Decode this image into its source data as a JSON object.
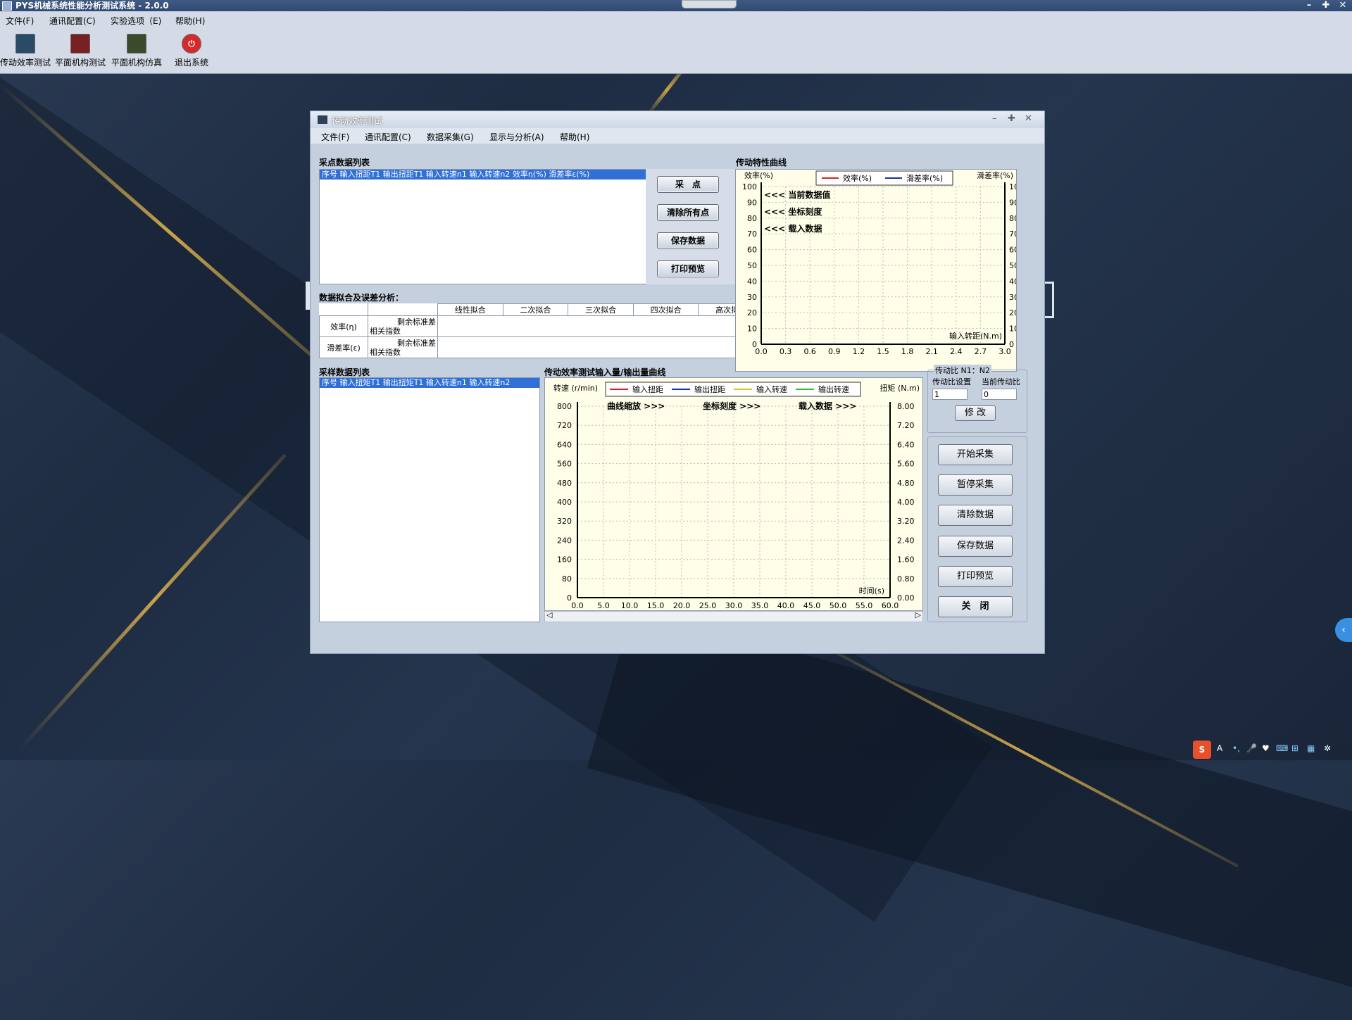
{
  "app": {
    "title": "PYS机械系统性能分析测试系统 - 2.0.0",
    "menu": [
      "文件(F)",
      "通讯配置(C)",
      "实验选项（E)",
      "帮助(H)"
    ],
    "toolbar": [
      {
        "label": "传动效率测试",
        "icon": "efficiency-monitor-icon",
        "color": "#2a4a66"
      },
      {
        "label": "平面机构测试",
        "icon": "mechanism-test-icon",
        "color": "#7a2020"
      },
      {
        "label": "平面机构仿真",
        "icon": "mechanism-sim-icon",
        "color": "#3a4a2a"
      },
      {
        "label": "退出系统",
        "icon": "power-icon",
        "color": "#d52a2a"
      }
    ],
    "window_buttons": [
      "–",
      "✚",
      "✕"
    ]
  },
  "window": {
    "title": "传动效率测试",
    "menu": [
      "文件(F)",
      "通讯配置(C)",
      "数据采集(G)",
      "显示与分析(A)",
      "帮助(H)"
    ],
    "buttons": [
      "–",
      "✚",
      "✕"
    ]
  },
  "point_list": {
    "label": "采点数据列表",
    "header": "序号  输入扭距T1  输出扭距T1  输入转速n1  输入转速n2  效率η(%)  滑差率ε(%)"
  },
  "point_buttons": [
    "采　点",
    "清除所有点",
    "保存数据",
    "打印预览"
  ],
  "fit": {
    "label": "数据拟合及误差分析：",
    "columns": [
      "线性拟合",
      "二次拟合",
      "三次拟合",
      "四次拟合",
      "高次拟合"
    ],
    "rows": [
      {
        "name": "效率(η)",
        "sub": [
          "剩余标准差",
          "相关指数"
        ]
      },
      {
        "name": "滑差率(ε)",
        "sub": [
          "剩余标准差",
          "相关指数"
        ]
      }
    ]
  },
  "char_chart": {
    "label": "传动特性曲线",
    "left_title": "效率(%)",
    "right_title": "滑差率(%)",
    "xlabel": "输入转距(N.m)",
    "legend": [
      {
        "name": "效率(%)",
        "color": "#e02020"
      },
      {
        "name": "滑差率(%)",
        "color": "#1a2fb0"
      }
    ],
    "annotations": [
      "<<< 当前数据值",
      "<<< 坐标刻度",
      "<<< 载入数据"
    ],
    "y_ticks": [
      "100",
      "90",
      "80",
      "70",
      "60",
      "50",
      "40",
      "30",
      "20",
      "10",
      "0"
    ],
    "x_ticks": [
      "0.0",
      "0.3",
      "0.6",
      "0.9",
      "1.2",
      "1.5",
      "1.8",
      "2.1",
      "2.4",
      "2.7",
      "3.0"
    ]
  },
  "sample_list": {
    "label": "采样数据列表",
    "header": "序号  输入扭矩T1  输出扭矩T1  输入转速n1  输入转速n2"
  },
  "io_chart": {
    "label": "传动效率测试输入量/输出量曲线",
    "left_title": "转速 (r/min)",
    "right_title": "扭矩 (N.m)",
    "xlabel": "时间(s)",
    "legend": [
      {
        "name": "输入扭距",
        "color": "#e02020"
      },
      {
        "name": "输出扭距",
        "color": "#1a2fb0"
      },
      {
        "name": "输入转速",
        "color": "#e0c020"
      },
      {
        "name": "输出转速",
        "color": "#30c030"
      }
    ],
    "annotations": [
      "曲线缩放 >>>",
      "坐标刻度 >>>",
      "载入数据 >>>"
    ],
    "y_left_ticks": [
      "800",
      "720",
      "640",
      "560",
      "480",
      "400",
      "320",
      "240",
      "160",
      "80",
      "0"
    ],
    "y_right_ticks": [
      "8.00",
      "7.20",
      "6.40",
      "5.60",
      "4.80",
      "4.00",
      "3.20",
      "2.40",
      "1.60",
      "0.80",
      "0.00"
    ],
    "x_ticks": [
      "0.0",
      "5.0",
      "10.0",
      "15.0",
      "20.0",
      "25.0",
      "30.0",
      "35.0",
      "40.0",
      "45.0",
      "50.0",
      "55.0",
      "60.0"
    ]
  },
  "ratio": {
    "group_label": "传动比 N1：N2",
    "set_label": "传动比设置",
    "current_label": "当前传动比",
    "set_value": "1",
    "current_value": "0",
    "modify_button": "修 改"
  },
  "control_buttons": [
    "开始采集",
    "暂停采集",
    "清除数据",
    "保存数据",
    "打印预览",
    "关　闭"
  ]
}
